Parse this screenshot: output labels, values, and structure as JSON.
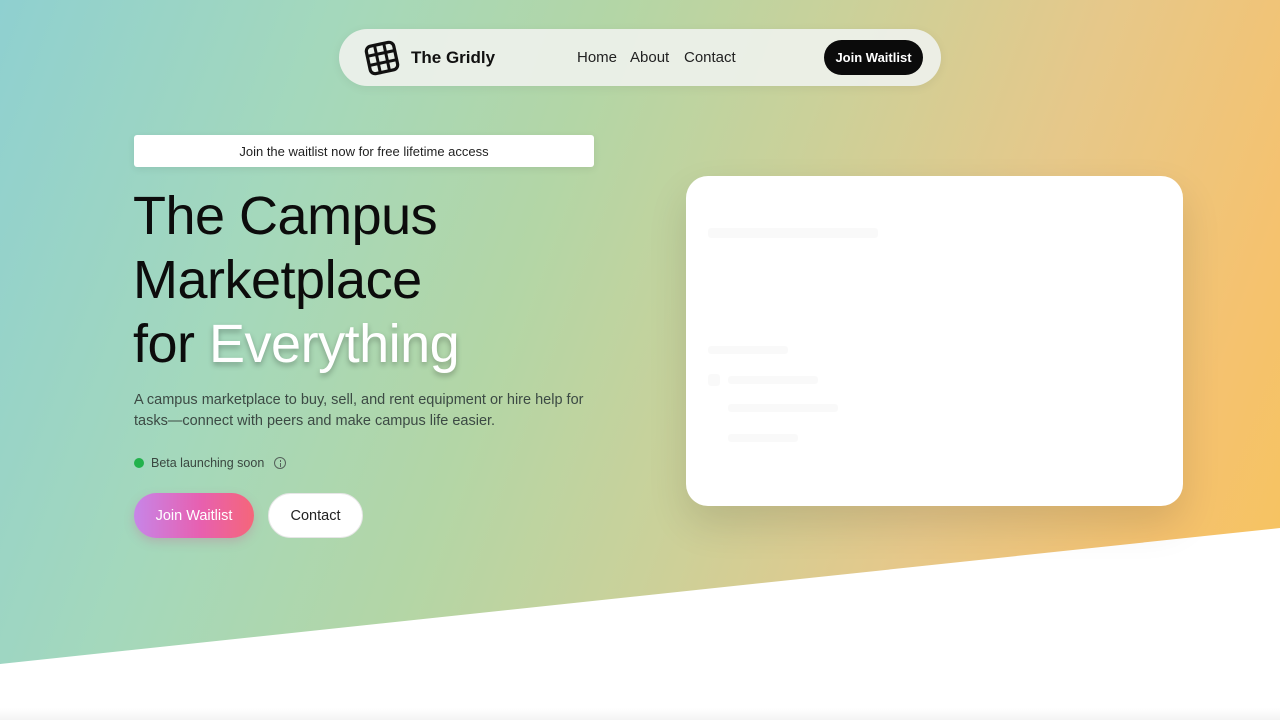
{
  "nav": {
    "brand": "The Gridly",
    "links": [
      {
        "label": "Home"
      },
      {
        "label": "About"
      },
      {
        "label": "Contact"
      }
    ],
    "cta_label": "Join Waitlist"
  },
  "hero": {
    "banner": "Join the waitlist now for free lifetime access",
    "headline": {
      "line1": "The Campus",
      "line2": "Marketplace",
      "line3_prefix": "for ",
      "line3_highlight": "Everything"
    },
    "description": "A campus marketplace to buy, sell, and rent equipment or hire help for tasks—connect with peers and make campus life easier.",
    "status": "Beta launching soon",
    "primary_button": "Join Waitlist",
    "secondary_button": "Contact"
  },
  "icons": {
    "logo": "grid-logo-icon",
    "status": "green-dot-icon",
    "info": "info-icon"
  },
  "colors": {
    "nav_cta_bg": "#0b0b0b",
    "status_dot": "#22b24c",
    "primary_gradient_start": "#c785e8",
    "primary_gradient_end": "#f5667a"
  }
}
